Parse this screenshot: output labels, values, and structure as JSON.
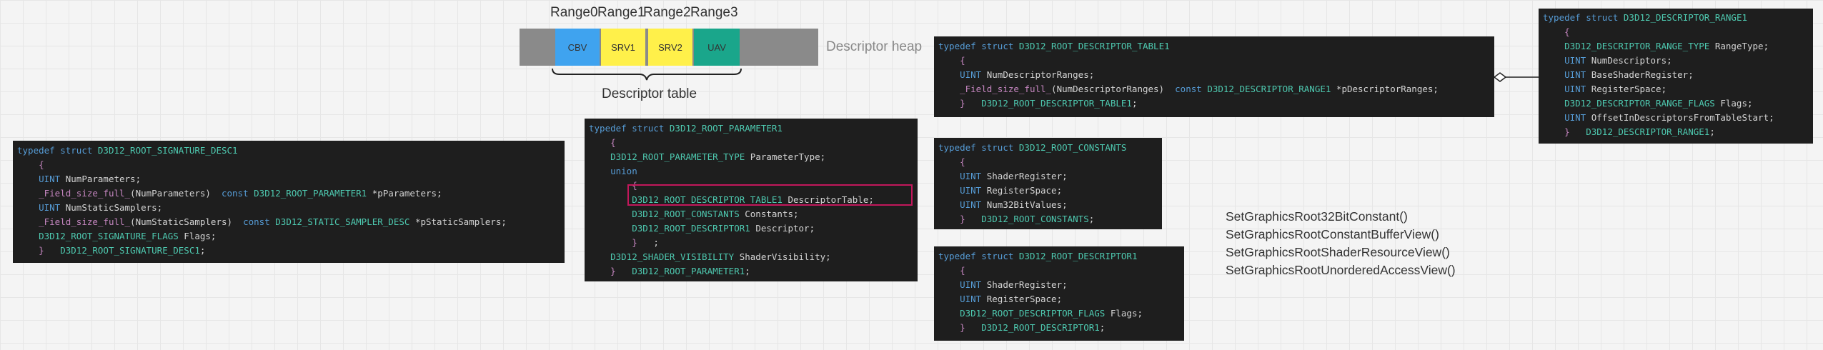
{
  "heap": {
    "range_labels": [
      "Range0",
      "Range1",
      "Range2",
      "Range3"
    ],
    "cells": [
      "CBV",
      "SRV1",
      "SRV2",
      "UAV"
    ],
    "colors": {
      "gray": "#8a8a8a",
      "CBV": "#3fa3ef",
      "SRV1": "#fff04a",
      "SRV2": "#fff04a",
      "UAV": "#1aa68b"
    },
    "heap_label": "Descriptor heap",
    "table_label": "Descriptor table"
  },
  "root_signature_desc": {
    "lines": [
      "typedef struct D3D12_ROOT_SIGNATURE_DESC1",
      "    {",
      "    UINT NumParameters;",
      "    _Field_size_full_(NumParameters)  const D3D12_ROOT_PARAMETER1 *pParameters;",
      "    UINT NumStaticSamplers;",
      "    _Field_size_full_(NumStaticSamplers)  const D3D12_STATIC_SAMPLER_DESC *pStaticSamplers;",
      "    D3D12_ROOT_SIGNATURE_FLAGS Flags;",
      "    }   D3D12_ROOT_SIGNATURE_DESC1;"
    ]
  },
  "root_parameter": {
    "lines": [
      "typedef struct D3D12_ROOT_PARAMETER1",
      "    {",
      "    D3D12_ROOT_PARAMETER_TYPE ParameterType;",
      "    union",
      "        {",
      "        D3D12_ROOT_DESCRIPTOR_TABLE1 DescriptorTable;",
      "        D3D12_ROOT_CONSTANTS Constants;",
      "        D3D12_ROOT_DESCRIPTOR1 Descriptor;",
      "        }   ;",
      "    D3D12_SHADER_VISIBILITY ShaderVisibility;",
      "    }   D3D12_ROOT_PARAMETER1;"
    ]
  },
  "descriptor_table": {
    "lines": [
      "typedef struct D3D12_ROOT_DESCRIPTOR_TABLE1",
      "    {",
      "    UINT NumDescriptorRanges;",
      "    _Field_size_full_(NumDescriptorRanges)  const D3D12_DESCRIPTOR_RANGE1 *pDescriptorRanges;",
      "    }   D3D12_ROOT_DESCRIPTOR_TABLE1;"
    ]
  },
  "root_constants": {
    "lines": [
      "typedef struct D3D12_ROOT_CONSTANTS",
      "    {",
      "    UINT ShaderRegister;",
      "    UINT RegisterSpace;",
      "    UINT Num32BitValues;",
      "    }   D3D12_ROOT_CONSTANTS;"
    ]
  },
  "root_descriptor": {
    "lines": [
      "typedef struct D3D12_ROOT_DESCRIPTOR1",
      "    {",
      "    UINT ShaderRegister;",
      "    UINT RegisterSpace;",
      "    D3D12_ROOT_DESCRIPTOR_FLAGS Flags;",
      "    }   D3D12_ROOT_DESCRIPTOR1;"
    ]
  },
  "descriptor_range": {
    "lines": [
      "typedef struct D3D12_DESCRIPTOR_RANGE1",
      "    {",
      "    D3D12_DESCRIPTOR_RANGE_TYPE RangeType;",
      "    UINT NumDescriptors;",
      "    UINT BaseShaderRegister;",
      "    UINT RegisterSpace;",
      "    D3D12_DESCRIPTOR_RANGE_FLAGS Flags;",
      "    UINT OffsetInDescriptorsFromTableStart;",
      "    }   D3D12_DESCRIPTOR_RANGE1;"
    ]
  },
  "api_calls": [
    "SetGraphicsRoot32BitConstant()",
    "SetGraphicsRootConstantBufferView()",
    "SetGraphicsRootShaderResourceView()",
    "SetGraphicsRootUnorderedAccessView()"
  ],
  "highlight_color": "#c2185b"
}
